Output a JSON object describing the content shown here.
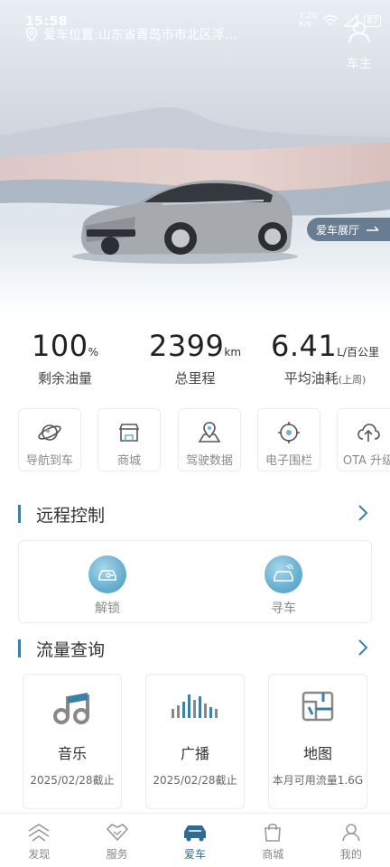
{
  "status_bar": {
    "time": "15:58",
    "net_speed": "1.20\nK/s",
    "battery": "87"
  },
  "header": {
    "location_text": "爱车位置:山东省青岛市市北区浮…",
    "owner_label": "车主"
  },
  "hero": {
    "showroom_label": "爱车展厅"
  },
  "stats": [
    {
      "value": "100",
      "unit": "%",
      "label": "剩余油量",
      "sub": ""
    },
    {
      "value": "2399",
      "unit": "km",
      "label": "总里程",
      "sub": ""
    },
    {
      "value": "6.41",
      "unit": "L/百公里",
      "label": "平均油耗",
      "sub": "(上周)"
    }
  ],
  "features": [
    {
      "label": "导航到车",
      "icon": "planet-icon"
    },
    {
      "label": "商城",
      "icon": "store-icon"
    },
    {
      "label": "驾驶数据",
      "icon": "map-pin-icon"
    },
    {
      "label": "电子围栏",
      "icon": "target-icon"
    },
    {
      "label": "OTA 升级",
      "icon": "cloud-upload-icon"
    }
  ],
  "remote": {
    "title": "远程控制",
    "buttons": [
      {
        "label": "解锁",
        "icon": "unlock-car-icon"
      },
      {
        "label": "寻车",
        "icon": "find-car-icon"
      }
    ]
  },
  "traffic": {
    "title": "流量查询",
    "cards": [
      {
        "name": "音乐",
        "sub": "2025/02/28截止",
        "icon": "music-icon"
      },
      {
        "name": "广播",
        "sub": "2025/02/28截止",
        "icon": "radio-icon"
      },
      {
        "name": "地图",
        "sub": "本月可用流量1.6G",
        "icon": "map-icon"
      }
    ]
  },
  "tabs": [
    {
      "label": "发现",
      "icon": "discover-icon",
      "active": false
    },
    {
      "label": "服务",
      "icon": "service-icon",
      "active": false
    },
    {
      "label": "爱车",
      "icon": "car-icon",
      "active": true
    },
    {
      "label": "商城",
      "icon": "shop-bag-icon",
      "active": false
    },
    {
      "label": "我的",
      "icon": "profile-icon",
      "active": false
    }
  ],
  "colors": {
    "accent": "#3d7fa6",
    "tab_active": "#2f6b92",
    "icon_blue": "#6cb3d2"
  }
}
